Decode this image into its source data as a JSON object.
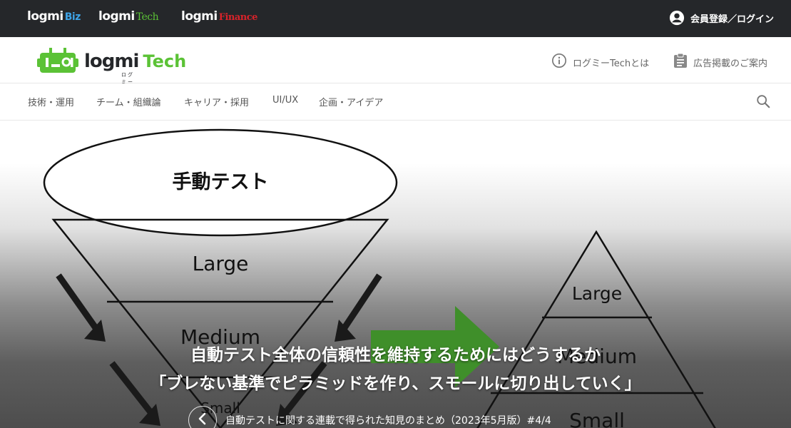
{
  "topbar": {
    "brands": [
      {
        "main": "logmi",
        "suffix": "Biz"
      },
      {
        "main": "logmi",
        "suffix": "Tech"
      },
      {
        "main": "logmi",
        "suffix": "Finance"
      }
    ],
    "login_label": "会員登録／ログイン",
    "login_icon": "account-circle-icon"
  },
  "header": {
    "logo_word": "logmi",
    "logo_kana": "ログミー",
    "logo_tech": "Tech",
    "about_label": "ログミーTechとは",
    "about_icon": "info-icon",
    "ads_label": "広告掲載のご案内",
    "ads_icon": "clipboard-icon"
  },
  "nav": {
    "categories": [
      "技術・運用",
      "チーム・組織論",
      "キャリア・採用",
      "UI/UX",
      "企画・アイデア"
    ],
    "search_icon": "search-icon"
  },
  "hero": {
    "diagram": {
      "manual": "手動テスト",
      "large": "Large",
      "medium": "Medium",
      "small": "Small",
      "pyr_large": "Large",
      "pyr_medium": "Medium",
      "pyr_small": "Small"
    },
    "title_line1": "自動テスト全体の信頼性を維持するためにはどうするか",
    "title_line2": "「ブレない基準でピラミッドを作り、スモールに切り出していく」",
    "series": "自動テストに関する連載で得られた知見のまとめ（2023年5月版）#4/4",
    "prev_icon": "chevron-left-icon"
  },
  "colors": {
    "topbar_bg": "#25272a",
    "biz_accent": "#3ea3e6",
    "tech_accent": "#5bc236",
    "finance_accent": "#d8232a",
    "arrow_green": "#3f8f2a"
  }
}
